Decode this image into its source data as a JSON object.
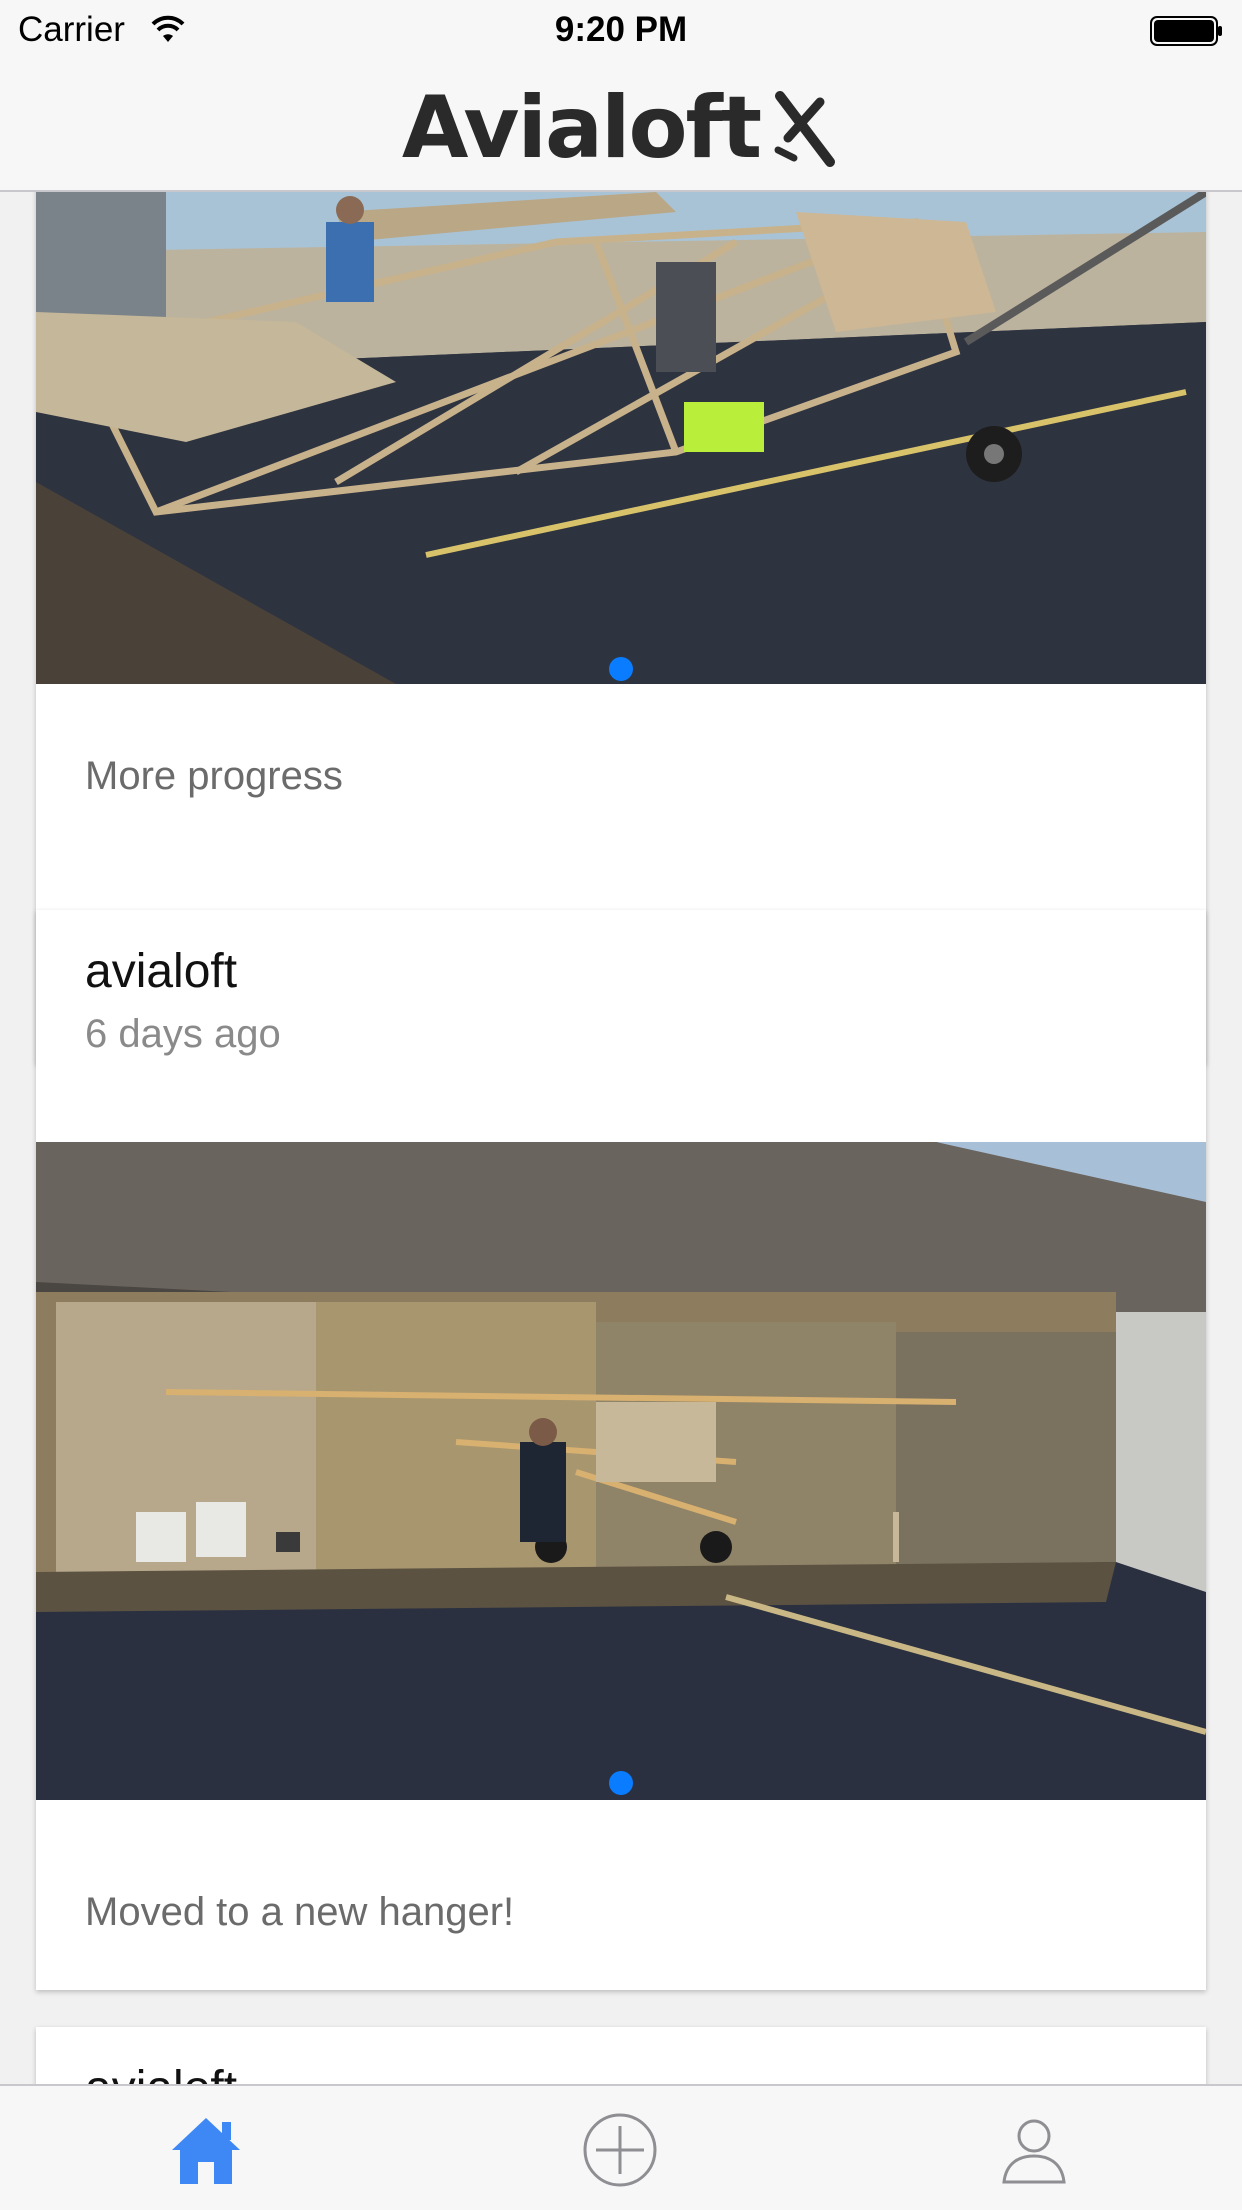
{
  "status_bar": {
    "carrier": "Carrier",
    "time": "9:20 PM"
  },
  "header": {
    "logo_text": "Avialoft",
    "logo_icon": "airplane-icon"
  },
  "feed": {
    "posts": [
      {
        "caption": "More progress",
        "image": "aircraft-fuselage-frame-outside-hangar"
      },
      {
        "author": "avialoft",
        "time_ago": "6 days ago",
        "caption": "Moved to a new hanger!",
        "image": "aircraft-frame-inside-open-hangar"
      },
      {
        "author": "avialoft"
      }
    ]
  },
  "tab_bar": {
    "items": [
      {
        "icon": "home-icon",
        "active": true
      },
      {
        "icon": "add-circle-icon",
        "active": false
      },
      {
        "icon": "profile-icon",
        "active": false
      }
    ],
    "active_color": "#3d88f5",
    "inactive_color": "#8e8e93"
  },
  "colors": {
    "accent": "#0a7cff"
  }
}
